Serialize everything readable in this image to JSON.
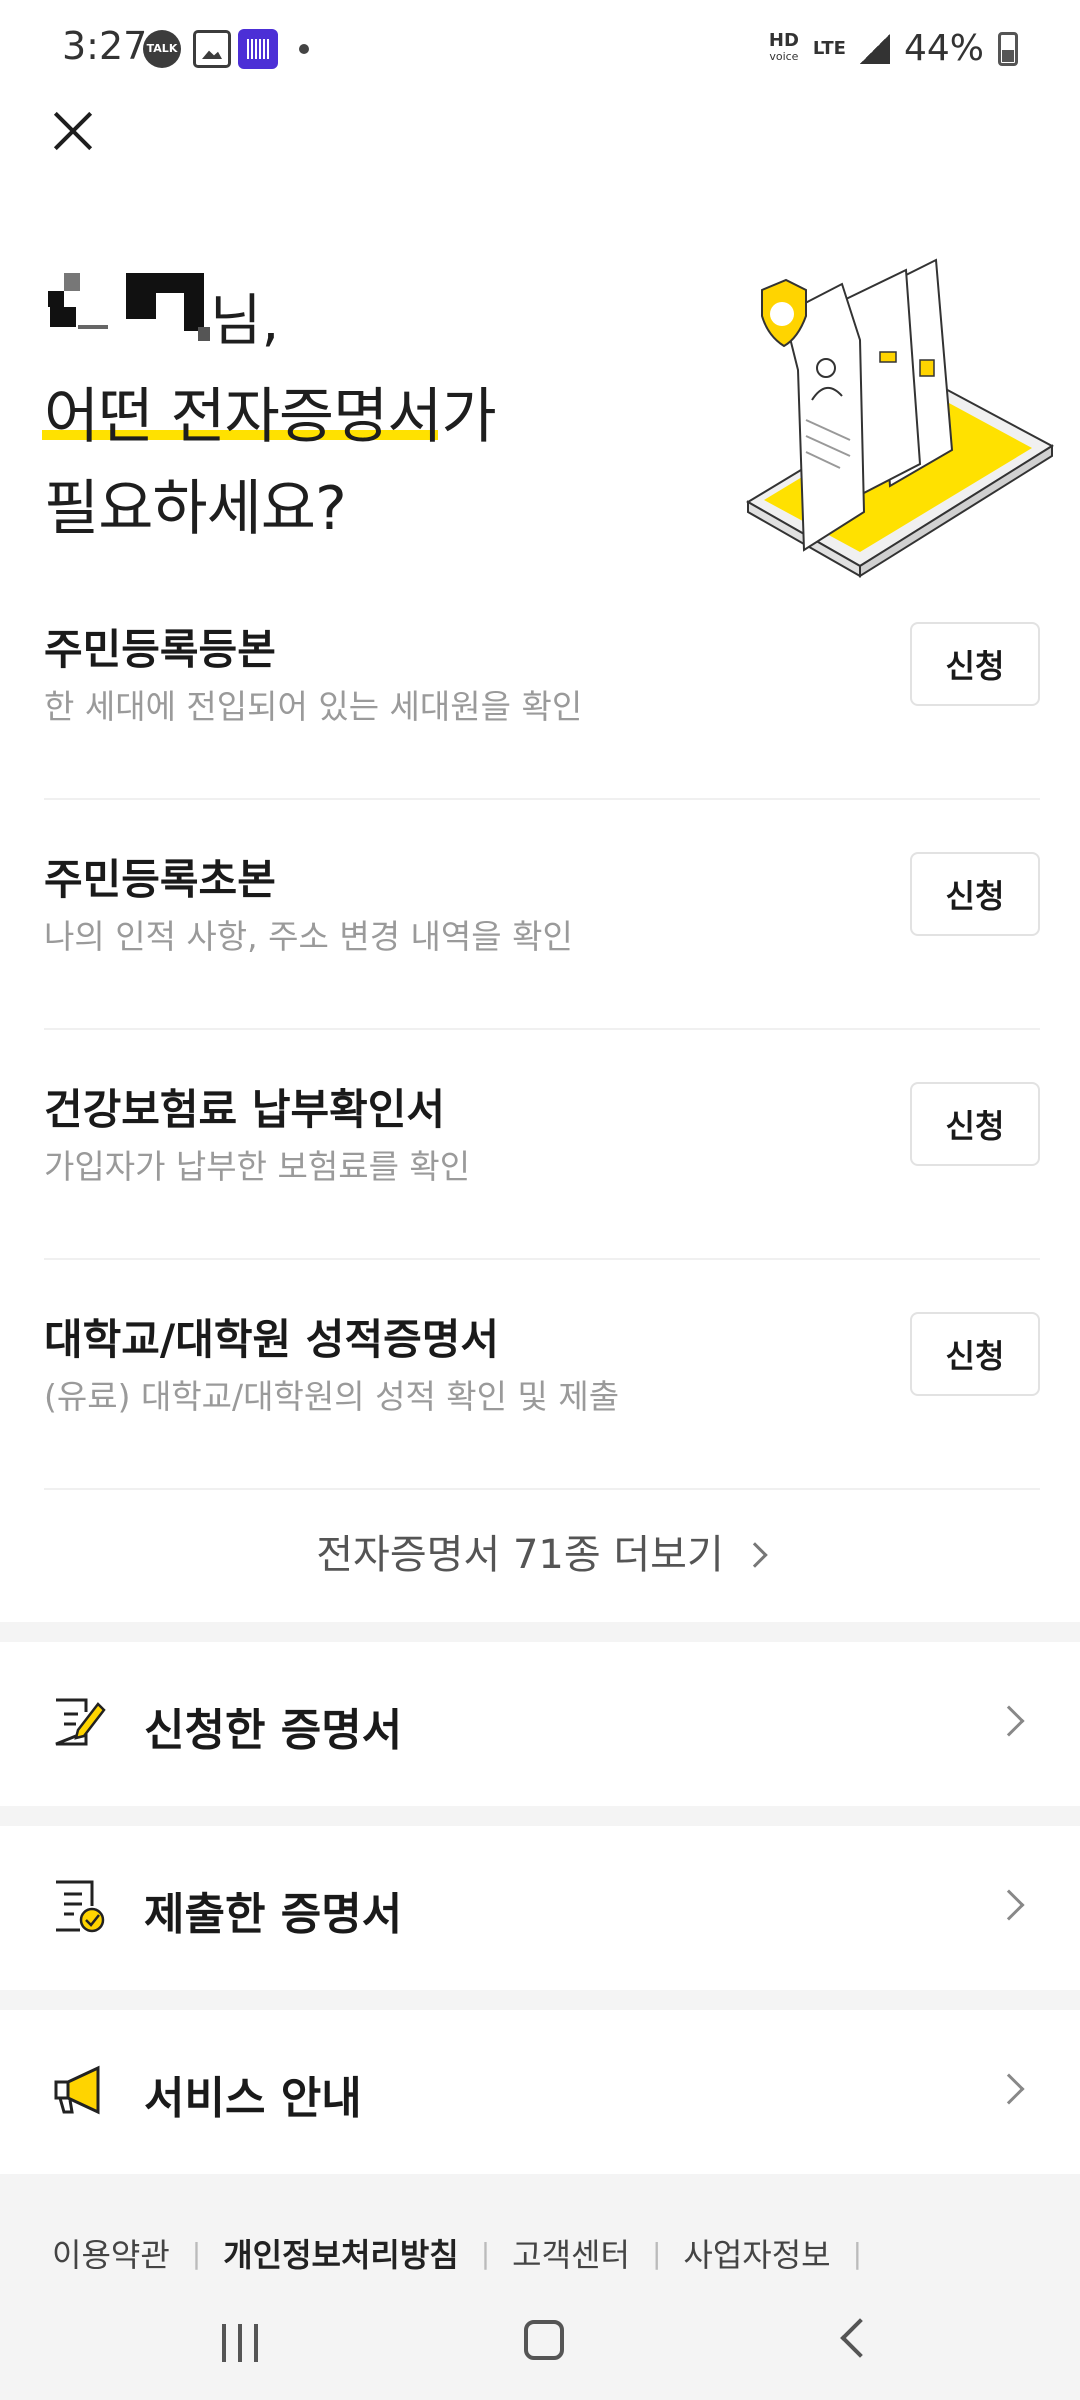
{
  "status_bar": {
    "time": "3:27",
    "talk_icon_label": "TALK",
    "hd_label": "HD",
    "voice_label": "voice",
    "lte_label": "LTE",
    "battery": "44%"
  },
  "heading": {
    "name_suffix": "님,",
    "line1": "어떤 전자증명서가",
    "line2": "필요하세요?"
  },
  "documents": [
    {
      "title": "주민등록등본",
      "desc": "한 세대에 전입되어 있는 세대원을 확인",
      "button": "신청"
    },
    {
      "title": "주민등록초본",
      "desc": "나의 인적 사항, 주소 변경 내역을 확인",
      "button": "신청"
    },
    {
      "title": "건강보험료 납부확인서",
      "desc": "가입자가 납부한 보험료를 확인",
      "button": "신청"
    },
    {
      "title": "대학교/대학원 성적증명서",
      "desc": "(유료) 대학교/대학원의 성적 확인 및 제출",
      "button": "신청"
    }
  ],
  "more_link": "전자증명서 71종 더보기",
  "menu": [
    {
      "label": "신청한 증명서",
      "icon": "edit-document-icon"
    },
    {
      "label": "제출한 증명서",
      "icon": "checked-document-icon"
    },
    {
      "label": "서비스 안내",
      "icon": "megaphone-icon"
    }
  ],
  "footer_links": [
    "이용약관",
    "개인정보처리방침",
    "고객센터",
    "사업자정보"
  ],
  "colors": {
    "accent": "#ffe100",
    "background": "#ffffff",
    "section_gap": "#f4f4f4"
  }
}
